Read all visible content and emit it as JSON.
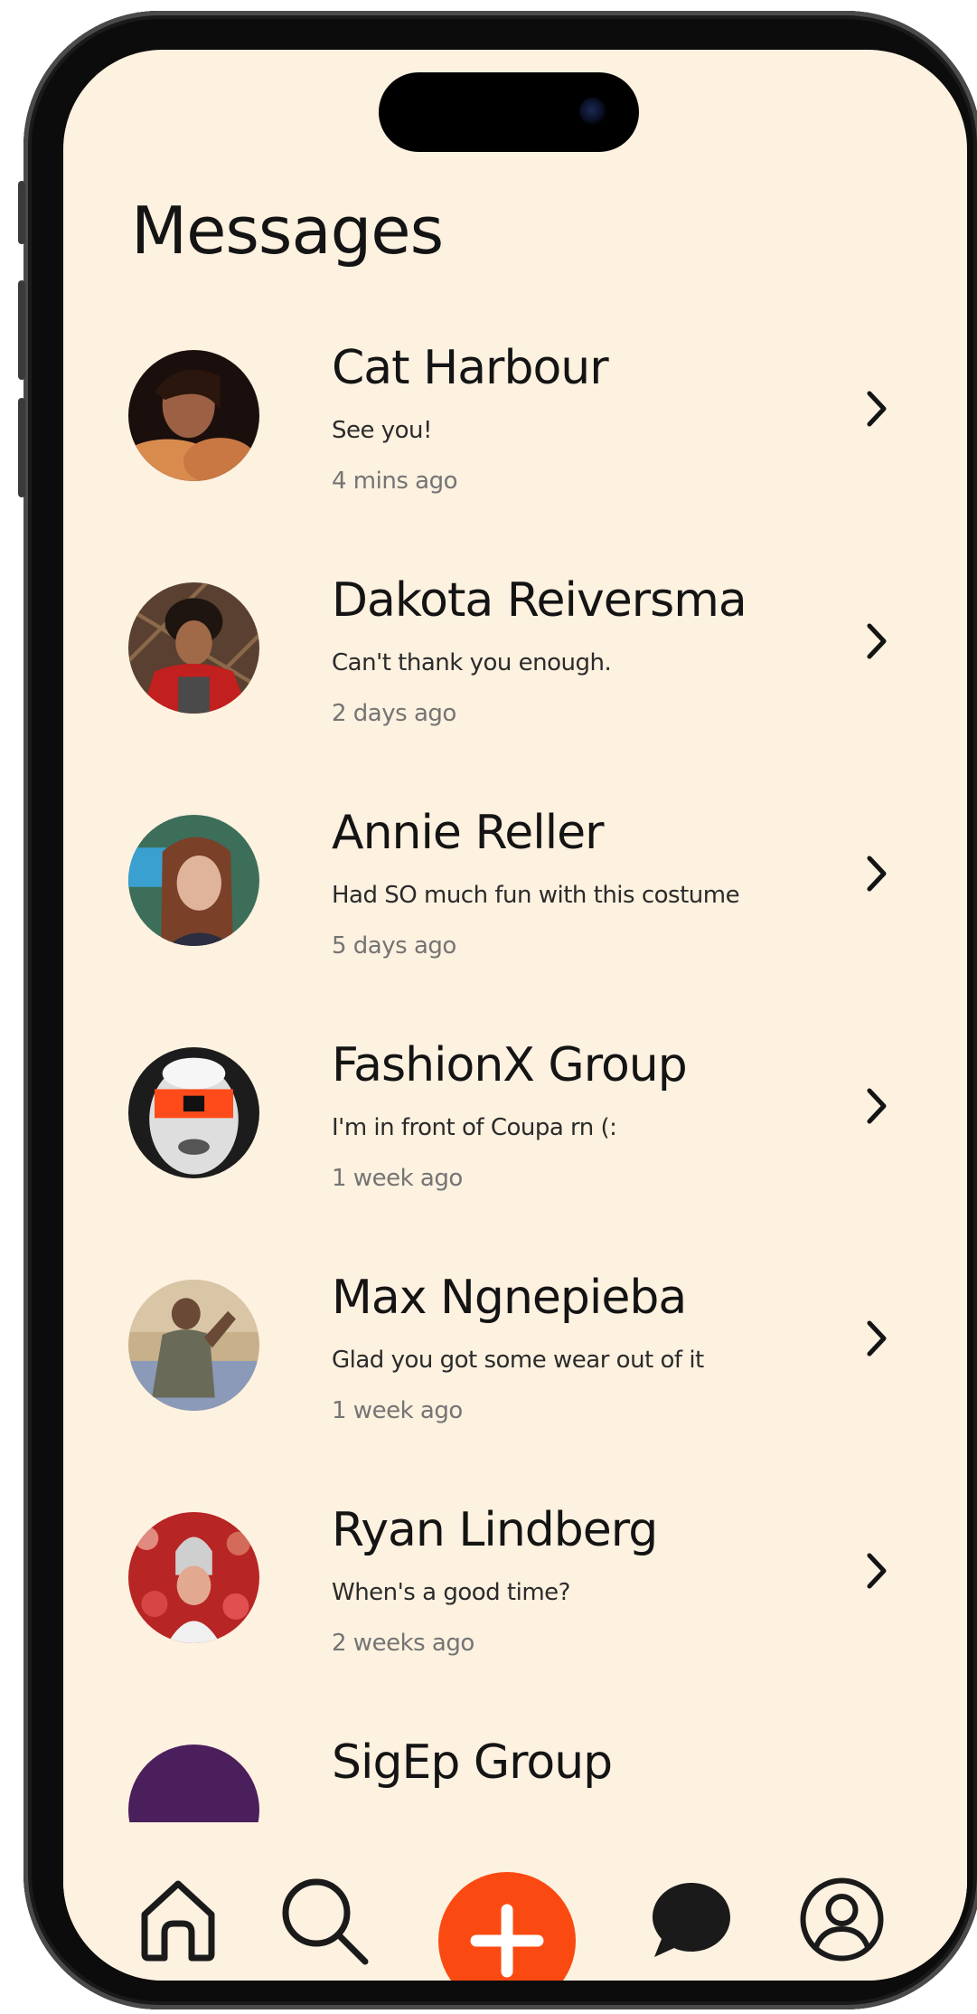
{
  "header": {
    "title": "Messages"
  },
  "conversations": [
    {
      "name": "Cat Harbour",
      "preview": "See you!",
      "time": "4 mins ago"
    },
    {
      "name": "Dakota Reiversma",
      "preview": "Can't thank you enough.",
      "time": "2 days ago"
    },
    {
      "name": "Annie Reller",
      "preview": "Had SO much fun with this costume",
      "time": "5 days ago"
    },
    {
      "name": "FashionX Group",
      "preview": "I'm in front of Coupa rn (:",
      "time": "1 week ago"
    },
    {
      "name": "Max Ngnepieba",
      "preview": "Glad you got some wear out of it",
      "time": "1 week ago"
    },
    {
      "name": "Ryan Lindberg",
      "preview": "When's a good time?",
      "time": "2 weeks ago"
    },
    {
      "name": "SigEp Group",
      "preview": "",
      "time": ""
    }
  ],
  "nav": {
    "home_icon": "home-icon",
    "search_icon": "search-icon",
    "add_icon": "plus-icon",
    "messages_icon": "chat-bubble-icon",
    "profile_icon": "user-circle-icon"
  },
  "colors": {
    "background": "#fdf1e0",
    "accent": "#fa4a12",
    "text": "#141414",
    "muted": "#747474"
  }
}
